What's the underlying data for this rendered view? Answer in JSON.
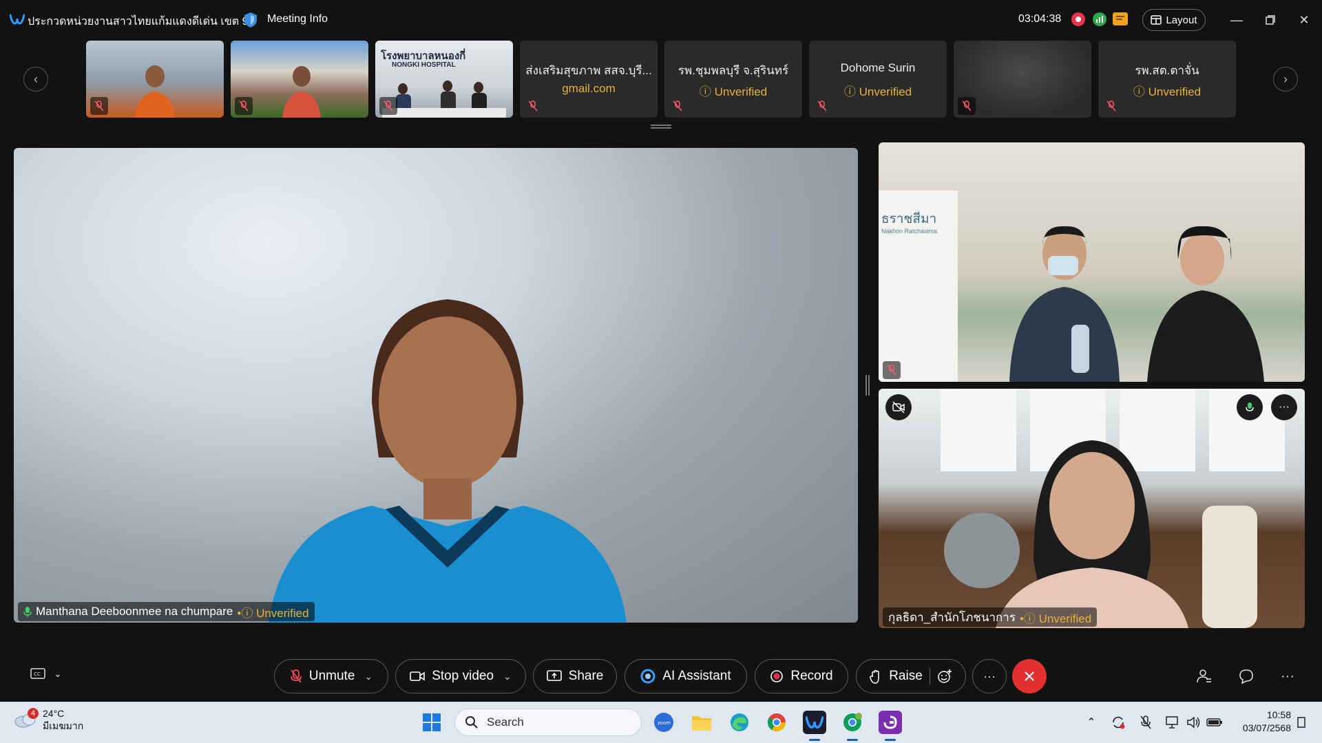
{
  "titlebar": {
    "meeting_title": "ประกวดหน่วยงานสาวไทยแก้มแดงดีเด่น เขต 9",
    "meeting_info": "Meeting Info",
    "timer": "03:04:38",
    "layout_label": "Layout"
  },
  "filmstrip": {
    "thumbs": [
      {
        "name": "",
        "sub": ""
      },
      {
        "name": "",
        "sub": ""
      },
      {
        "name": "โรงพยาบาลหนองกี่",
        "sub": "NONGKI HOSPITAL"
      },
      {
        "name": "ส่งเสริมสุขภาพ สสจ.บุรี...",
        "sub": "gmail.com"
      },
      {
        "name": "รพ.ชุมพลบุรี จ.สุรินทร์",
        "sub": "Unverified"
      },
      {
        "name": "Dohome Surin",
        "sub": "Unverified"
      },
      {
        "name": "",
        "sub": ""
      },
      {
        "name": "รพ.สต.ตาจั่น",
        "sub": "Unverified"
      }
    ]
  },
  "main_video": {
    "name": "Manthana Deeboonmee na chumpare",
    "status": "Unverified"
  },
  "side_video1": {
    "sign_text": "ธราชสีมา",
    "sign_sub": "Nakhon Ratchasima"
  },
  "side_video2": {
    "name": "กุลธิดา_สำนักโภชนาการ",
    "status": "Unverified"
  },
  "controls": {
    "unmute": "Unmute",
    "stop_video": "Stop video",
    "share": "Share",
    "ai_assistant": "AI Assistant",
    "record": "Record",
    "raise": "Raise"
  },
  "taskbar": {
    "temperature": "24°C",
    "weather_desc": "มีเมฆมาก",
    "weather_badge": "4",
    "search_label": "Search",
    "time": "10:58",
    "date": "03/07/2568"
  },
  "colors": {
    "accent_warning": "#e8b23a",
    "leave_red": "#e0302f",
    "record_red": "#e8334a"
  }
}
